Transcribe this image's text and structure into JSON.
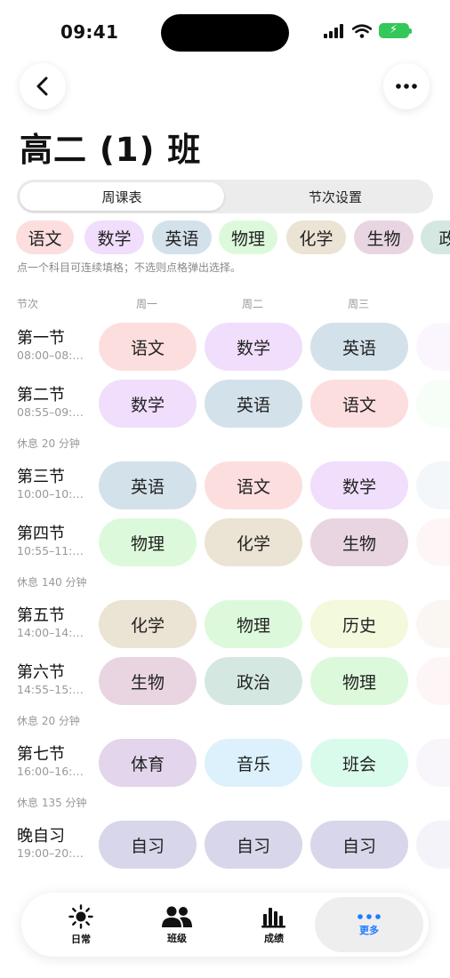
{
  "status": {
    "time": "09:41"
  },
  "header": {
    "title": "高二 (1) 班"
  },
  "segments": {
    "schedule": "周课表",
    "period_settings": "节次设置"
  },
  "subject_chips": [
    {
      "label": "语文",
      "color": "#fddede"
    },
    {
      "label": "数学",
      "color": "#f0defc"
    },
    {
      "label": "英语",
      "color": "#d3e1ea"
    },
    {
      "label": "物理",
      "color": "#dcfadb"
    },
    {
      "label": "化学",
      "color": "#ebe3d3"
    },
    {
      "label": "生物",
      "color": "#e9d5e1"
    },
    {
      "label": "政",
      "color": "#d4e8e1"
    }
  ],
  "hint": "点一个科目可连续填格；不选则点格弹出选择。",
  "grid_header": {
    "period": "节次",
    "mon": "周一",
    "tue": "周二",
    "wed": "周三"
  },
  "rows": [
    {
      "type": "period",
      "name": "第一节",
      "time": "08:00–08:…",
      "cells": [
        {
          "label": "语文",
          "color": "#fddede"
        },
        {
          "label": "数学",
          "color": "#f0defc"
        },
        {
          "label": "英语",
          "color": "#d3e1ea"
        }
      ],
      "next_color": "#f8effe"
    },
    {
      "type": "period",
      "name": "第二节",
      "time": "08:55–09:…",
      "cells": [
        {
          "label": "数学",
          "color": "#f0defc"
        },
        {
          "label": "英语",
          "color": "#d3e1ea"
        },
        {
          "label": "语文",
          "color": "#fddede"
        }
      ],
      "next_color": "#effdf0"
    },
    {
      "type": "break",
      "text": "休息 20 分钟"
    },
    {
      "type": "period",
      "name": "第三节",
      "time": "10:00–10:…",
      "cells": [
        {
          "label": "英语",
          "color": "#d3e1ea"
        },
        {
          "label": "语文",
          "color": "#fddede"
        },
        {
          "label": "数学",
          "color": "#f0defc"
        }
      ],
      "next_color": "#eaf1f5"
    },
    {
      "type": "period",
      "name": "第四节",
      "time": "10:55–11:…",
      "cells": [
        {
          "label": "物理",
          "color": "#dcfadb"
        },
        {
          "label": "化学",
          "color": "#ebe3d3"
        },
        {
          "label": "生物",
          "color": "#e9d5e1"
        }
      ],
      "next_color": "#fdeeee"
    },
    {
      "type": "break",
      "text": "休息 140 分钟"
    },
    {
      "type": "period",
      "name": "第五节",
      "time": "14:00–14:…",
      "cells": [
        {
          "label": "化学",
          "color": "#ebe3d3"
        },
        {
          "label": "物理",
          "color": "#dcfadb"
        },
        {
          "label": "历史",
          "color": "#f3f9dd"
        }
      ],
      "next_color": "#f5f1e9"
    },
    {
      "type": "period",
      "name": "第六节",
      "time": "14:55–15:…",
      "cells": [
        {
          "label": "生物",
          "color": "#e9d5e1"
        },
        {
          "label": "政治",
          "color": "#d4e8e1"
        },
        {
          "label": "物理",
          "color": "#dcfadb"
        }
      ],
      "next_color": "#fdeeee"
    },
    {
      "type": "break",
      "text": "休息 20 分钟"
    },
    {
      "type": "period",
      "name": "第七节",
      "time": "16:00–16:…",
      "cells": [
        {
          "label": "体育",
          "color": "#e3d5ec"
        },
        {
          "label": "音乐",
          "color": "#dcf1fb"
        },
        {
          "label": "班会",
          "color": "#d9fbeb"
        }
      ],
      "next_color": "#f3ecf8"
    },
    {
      "type": "break",
      "text": "休息 135 分钟"
    },
    {
      "type": "period",
      "name": "晚自习",
      "time": "19:00–20:…",
      "cells": [
        {
          "label": "自习",
          "color": "#d7d6ea"
        },
        {
          "label": "自习",
          "color": "#d7d6ea"
        },
        {
          "label": "自习",
          "color": "#d7d6ea"
        }
      ],
      "next_color": "#ebeaf5"
    }
  ],
  "tabbar": [
    {
      "label": "日常",
      "icon": "sun-icon",
      "active": false
    },
    {
      "label": "班级",
      "icon": "people-icon",
      "active": false
    },
    {
      "label": "成绩",
      "icon": "bar-chart-icon",
      "active": false
    },
    {
      "label": "更多",
      "icon": "more-dots-icon",
      "active": true
    }
  ],
  "colors": {
    "accent": "#1e7bff",
    "battery": "#34c759"
  }
}
